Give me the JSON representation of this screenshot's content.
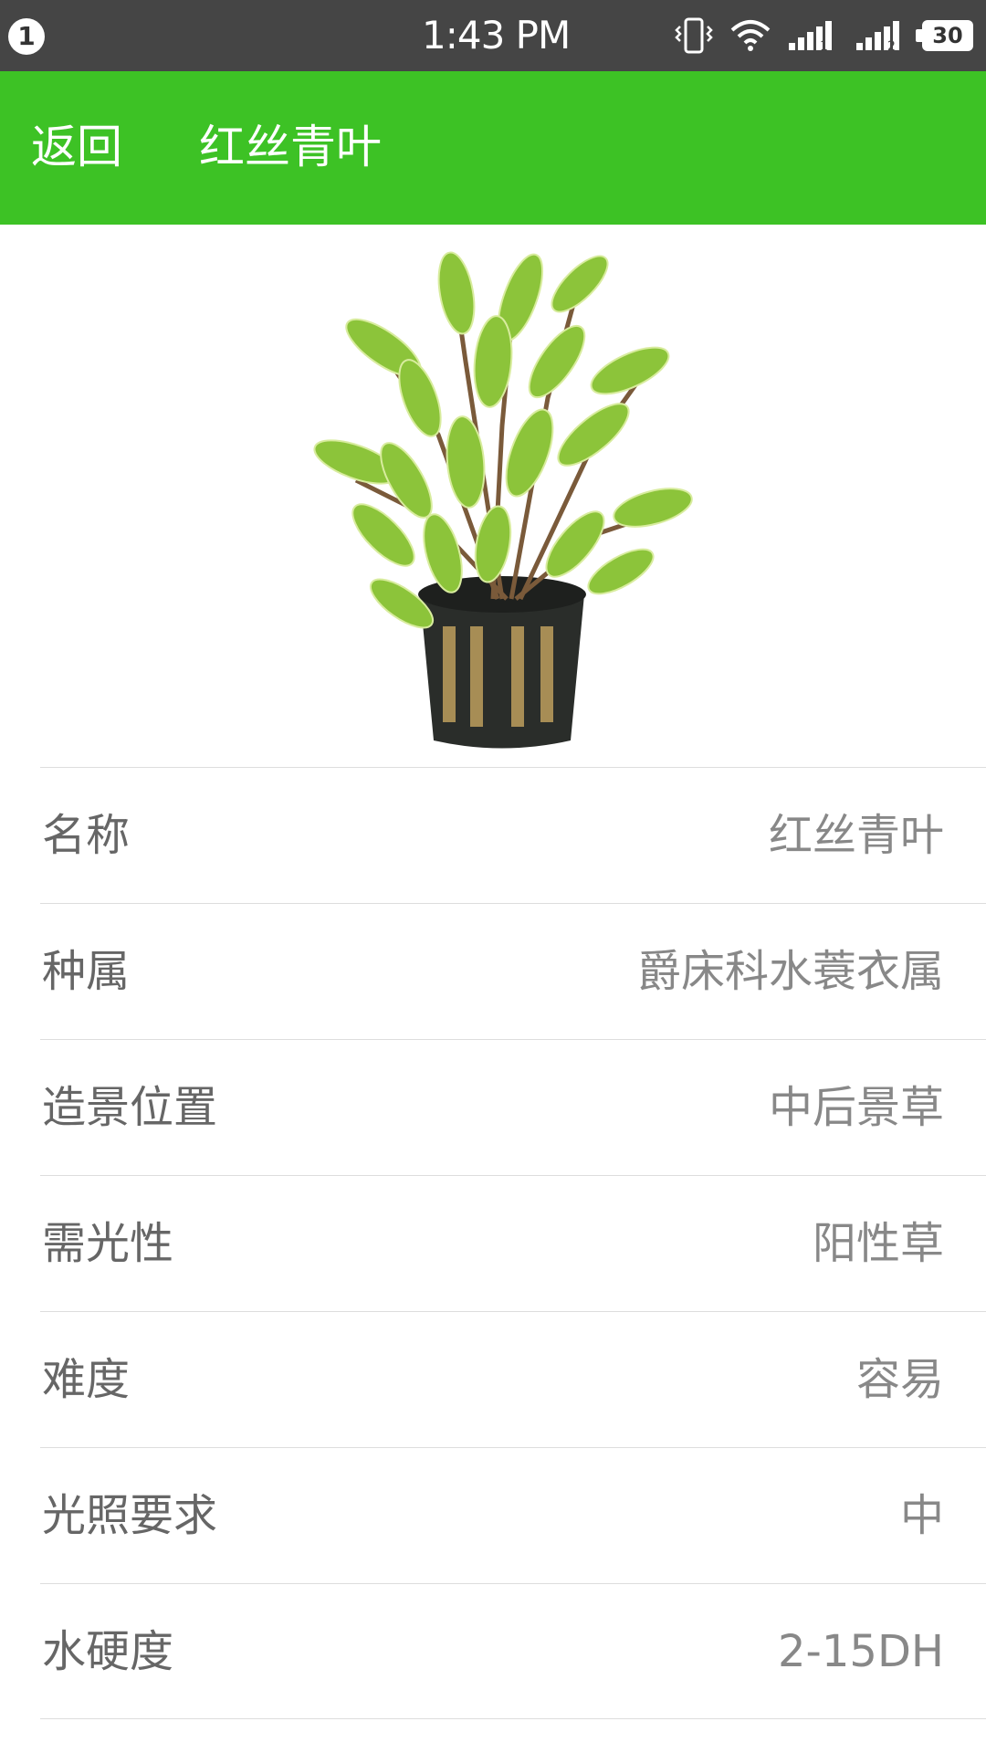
{
  "status_bar": {
    "notification_count": "1",
    "time": "1:43 PM",
    "battery": "30",
    "icons": [
      "vibrate-icon",
      "wifi-icon",
      "signal-sim1-icon",
      "signal-sim2-icon",
      "battery-icon"
    ]
  },
  "app_bar": {
    "back_label": "返回",
    "title": "红丝青叶",
    "color": "#3dc225"
  },
  "hero_image": {
    "icon": "potted-plant-image"
  },
  "details": [
    {
      "label": "名称",
      "value": "红丝青叶"
    },
    {
      "label": "种属",
      "value": "爵床科水蓑衣属"
    },
    {
      "label": "造景位置",
      "value": "中后景草"
    },
    {
      "label": "需光性",
      "value": "阳性草"
    },
    {
      "label": "难度",
      "value": "容易"
    },
    {
      "label": "光照要求",
      "value": "中"
    },
    {
      "label": "水硬度",
      "value": "2-15DH"
    }
  ]
}
